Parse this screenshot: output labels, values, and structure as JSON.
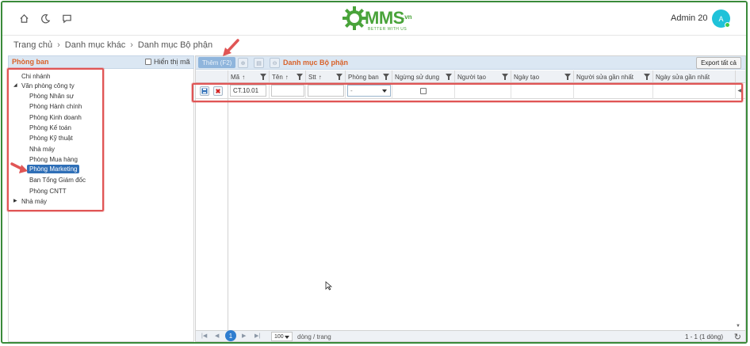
{
  "header": {
    "logo_text": "MMS",
    "logo_domain": ".vn",
    "logo_tagline": "BETTER WITH US",
    "user_name": "Admin 20",
    "avatar_initial": "A"
  },
  "breadcrumb": [
    "Trang chủ",
    "Danh mục khác",
    "Danh mục Bộ phận"
  ],
  "left_panel": {
    "title": "Phòng ban",
    "show_code_label": "Hiển thị mã",
    "tree": [
      {
        "label": "Chi nhánh"
      },
      {
        "label": "Văn phòng công ty"
      },
      {
        "label": "Phòng Nhân sự"
      },
      {
        "label": "Phòng Hành chính"
      },
      {
        "label": "Phòng Kinh doanh"
      },
      {
        "label": "Phòng Kế toán"
      },
      {
        "label": "Phòng Kỹ thuật"
      },
      {
        "label": "Nhà máy"
      },
      {
        "label": "Phòng Mua hàng"
      },
      {
        "label": "Phòng Marketing"
      },
      {
        "label": "Ban Tổng Giám đốc"
      },
      {
        "label": "Phòng CNTT"
      },
      {
        "label": "Nhà máy"
      }
    ]
  },
  "toolbar": {
    "add_label": "Thêm (F2)",
    "title": "Danh mục Bộ phận",
    "export_label": "Export tất cả"
  },
  "grid": {
    "columns": [
      "Mã",
      "Tên",
      "Stt",
      "Phòng ban",
      "Ngừng sử dụng",
      "Người tạo",
      "Ngày tạo",
      "Người sửa gần nhất",
      "Ngày sửa gần nhất"
    ],
    "edit_row": {
      "code_value": "CT.10.01",
      "name_value": "",
      "order_value": "",
      "department_value": "-"
    }
  },
  "pager": {
    "current_page": "1",
    "page_size": "100",
    "page_size_label": "dòng / trang",
    "info": "1 - 1 (1 dòng)"
  },
  "colors": {
    "brand_green": "#49a33a",
    "accent_orange": "#d9622a",
    "highlight_red": "#e05555",
    "selected_blue": "#2f6fb7"
  }
}
